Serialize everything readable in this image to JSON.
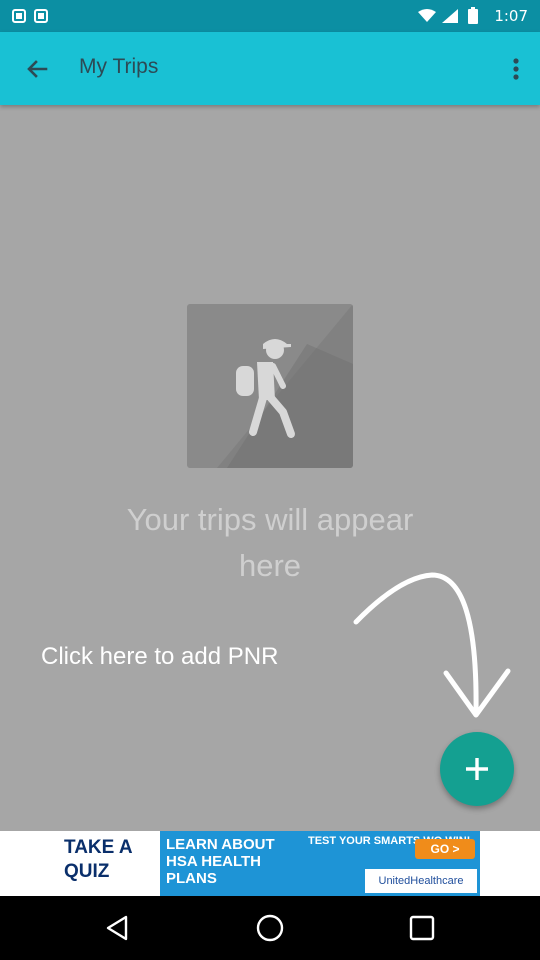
{
  "status_bar": {
    "time": "1:07",
    "icons": [
      "notification-icon",
      "notification-icon",
      "wifi-icon",
      "signal-icon",
      "battery-icon"
    ]
  },
  "app_bar": {
    "title": "My Trips",
    "back_icon": "arrow-back-icon",
    "menu_icon": "more-vert-icon"
  },
  "empty_state": {
    "illustration": "hiker-icon",
    "message": "Your trips will appear here"
  },
  "hint": {
    "text": "Click here to add PNR"
  },
  "fab": {
    "icon": "plus-icon"
  },
  "ad": {
    "left_text": "TAKE A QUIZ",
    "middle_text": "LEARN ABOUT HSA HEALTH PLANS",
    "top_right_text": "TEST YOUR SMARTS WO WIN!",
    "cta": "GO >",
    "brand": "UnitedHealthcare"
  },
  "nav_bar": {
    "buttons": [
      "back-triangle-icon",
      "home-circle-icon",
      "recents-square-icon"
    ]
  },
  "colors": {
    "status_bar": "#0c8fa3",
    "app_bar": "#19c1d4",
    "content_bg": "#a6a6a6",
    "fab": "#14a091"
  }
}
